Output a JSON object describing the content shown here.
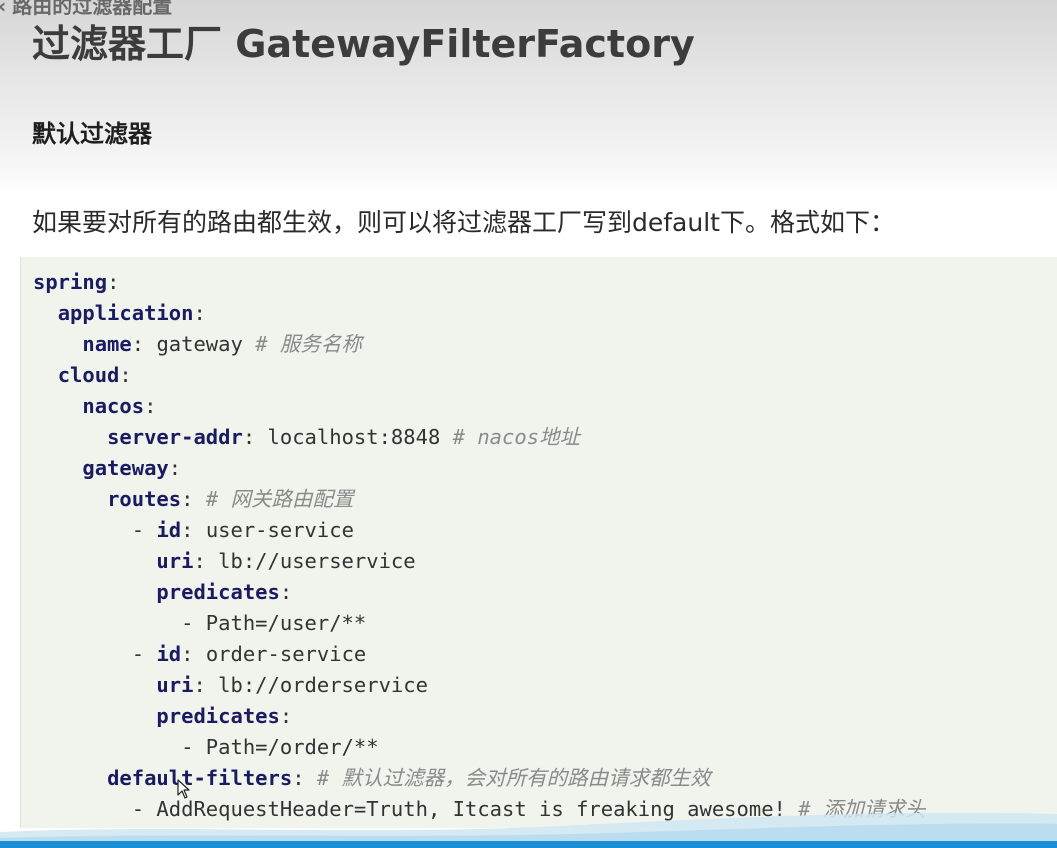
{
  "breadcrumb": {
    "chevron": "‹",
    "text": "路由的过滤器配置"
  },
  "page_title": "过滤器工厂 GatewayFilterFactory",
  "section_heading": "默认过滤器",
  "intro": "如果要对所有的路由都生效，则可以将过滤器工厂写到default下。格式如下：",
  "code": {
    "language": "yaml",
    "lines": [
      {
        "indent": 0,
        "key": "spring",
        "punct": ":",
        "value": "",
        "comment": ""
      },
      {
        "indent": 2,
        "key": "application",
        "punct": ":",
        "value": "",
        "comment": ""
      },
      {
        "indent": 4,
        "key": "name",
        "punct": ": ",
        "value": "gateway ",
        "comment": "# 服务名称"
      },
      {
        "indent": 2,
        "key": "cloud",
        "punct": ":",
        "value": "",
        "comment": ""
      },
      {
        "indent": 4,
        "key": "nacos",
        "punct": ":",
        "value": "",
        "comment": ""
      },
      {
        "indent": 6,
        "key": "server-addr",
        "punct": ": ",
        "value": "localhost:8848 ",
        "comment": "# nacos地址"
      },
      {
        "indent": 4,
        "key": "gateway",
        "punct": ":",
        "value": "",
        "comment": ""
      },
      {
        "indent": 6,
        "key": "routes",
        "punct": ": ",
        "value": "",
        "comment": "# 网关路由配置"
      },
      {
        "indent": 8,
        "prefix": "- ",
        "key": "id",
        "punct": ": ",
        "value": "user-service",
        "comment": ""
      },
      {
        "indent": 10,
        "key": "uri",
        "punct": ": ",
        "value": "lb://userservice",
        "comment": ""
      },
      {
        "indent": 10,
        "key": "predicates",
        "punct": ":",
        "value": "",
        "comment": ""
      },
      {
        "indent": 12,
        "key": "",
        "punct": "",
        "value": "- Path=/user/**",
        "comment": ""
      },
      {
        "indent": 8,
        "prefix": "- ",
        "key": "id",
        "punct": ": ",
        "value": "order-service",
        "comment": ""
      },
      {
        "indent": 10,
        "key": "uri",
        "punct": ": ",
        "value": "lb://orderservice",
        "comment": ""
      },
      {
        "indent": 10,
        "key": "predicates",
        "punct": ":",
        "value": "",
        "comment": ""
      },
      {
        "indent": 12,
        "key": "",
        "punct": "",
        "value": "- Path=/order/**",
        "comment": ""
      },
      {
        "indent": 6,
        "key": "default-filters",
        "punct": ": ",
        "value": "",
        "comment": "# 默认过滤器，会对所有的路由请求都生效"
      },
      {
        "indent": 8,
        "key": "",
        "punct": "",
        "value": "- AddRequestHeader=Truth, Itcast is freaking awesome! ",
        "comment": "# 添加请求头"
      }
    ]
  },
  "colors": {
    "code_background": "#f1f4ec",
    "yaml_key": "#1b1b62",
    "comment": "#8a8a8a",
    "bottom_bar": "#1a8fd6"
  },
  "icons": {
    "cursor": "mouse-pointer-icon"
  }
}
